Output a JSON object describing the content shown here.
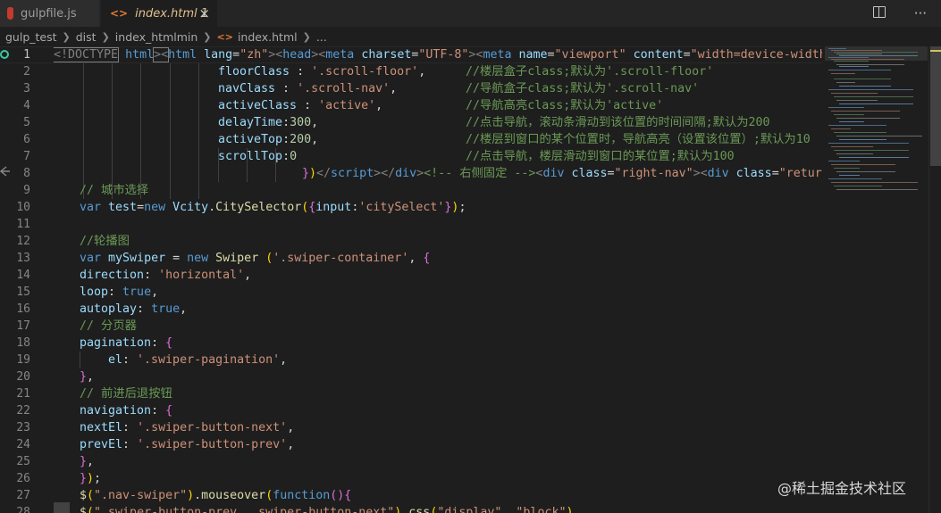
{
  "tabs": [
    {
      "label": "gulpfile.js",
      "icon": "gulp-icon",
      "active": false
    },
    {
      "label": "index.html",
      "icon": "html-icon",
      "badge": "1",
      "close": "×",
      "active": true
    }
  ],
  "breadcrumb": [
    "gulp_test",
    "dist",
    "index_htmlmin",
    "index.html",
    "..."
  ],
  "line_numbers": [
    "1",
    "2",
    "3",
    "4",
    "5",
    "6",
    "7",
    "8",
    "9",
    "10",
    "11",
    "12",
    "13",
    "14",
    "15",
    "16",
    "17",
    "18",
    "19",
    "20",
    "21",
    "22",
    "23",
    "24",
    "25",
    "26",
    "27",
    "28"
  ],
  "code": {
    "l1": [
      "<!DOCTYPE",
      " html",
      "><",
      "html",
      " lang",
      "=",
      "\"zh\"",
      "><",
      "head",
      "><",
      "meta",
      " charset",
      "=",
      "\"UTF-8\"",
      "><",
      "meta",
      " name",
      "=",
      "\"viewport\"",
      " content",
      "=",
      "\"width=device-width,ini"
    ],
    "l2": [
      "floorClass",
      " : ",
      "'.scroll-floor'",
      ",",
      "//楼层盒子class;默认为'.scroll-floor'"
    ],
    "l3": [
      "navClass",
      " : ",
      "'.scroll-nav'",
      ",",
      "//导航盒子class;默认为'.scroll-nav'"
    ],
    "l4": [
      "activeClass",
      " : ",
      "'active'",
      ",",
      "//导航高亮class;默认为'active'"
    ],
    "l5": [
      "delayTime",
      ":",
      "300",
      ",",
      "//点击导航，滚动条滑动到该位置的时间间隔;默认为200"
    ],
    "l6": [
      "activeTop",
      ":",
      "200",
      ",",
      "//楼层到窗口的某个位置时，导航高亮（设置该位置）;默认为10"
    ],
    "l7": [
      "scrollTop",
      ":",
      "0",
      "//点击导航，楼层滑动到窗口的某位置;默认为100"
    ],
    "l8": [
      "}",
      ")",
      "</",
      "script",
      "></",
      "div",
      ">",
      "<!-- 右侧固定 -->",
      "<",
      "div",
      " class",
      "=",
      "\"right-nav\"",
      "><",
      "div",
      " class",
      "=",
      "\"return-t"
    ],
    "l9": "// 城市选择",
    "l10": [
      "var",
      " test",
      "=",
      "new",
      " Vcity",
      ".",
      "CitySelector",
      "(",
      "{",
      "input",
      ":",
      "'citySelect'",
      "}",
      ")",
      ";"
    ],
    "l12": "//轮播图",
    "l13": [
      "var",
      " mySwiper",
      " = ",
      "new",
      " Swiper",
      " (",
      "'.swiper-container'",
      ", ",
      "{"
    ],
    "l14": [
      "direction",
      ": ",
      "'horizontal'",
      ","
    ],
    "l15": [
      "loop",
      ": ",
      "true",
      ","
    ],
    "l16": [
      "autoplay",
      ": ",
      "true",
      ","
    ],
    "l17": "// 分页器",
    "l18": [
      "pagination",
      ": ",
      "{"
    ],
    "l19": [
      "el",
      ": ",
      "'.swiper-pagination'",
      ","
    ],
    "l20": [
      "}",
      ","
    ],
    "l21": "// 前进后退按钮",
    "l22": [
      "navigation",
      ": ",
      "{"
    ],
    "l23": [
      "nextEl",
      ": ",
      "'.swiper-button-next'",
      ","
    ],
    "l24": [
      "prevEl",
      ": ",
      "'.swiper-button-prev'",
      ","
    ],
    "l25": [
      "}",
      ","
    ],
    "l26": [
      "}",
      ")",
      ";"
    ],
    "l27": [
      "$",
      "(",
      "\".nav-swiper\"",
      ")",
      ".",
      "mouseover",
      "(",
      "function",
      "(",
      ")",
      "{"
    ],
    "l28": [
      "$",
      "(",
      "\".swiper-button-prev, .swiper-button-next\"",
      ")",
      ".",
      "css",
      "(",
      "\"display\"",
      ", ",
      "\"block\"",
      ")"
    ]
  },
  "watermark": "@稀土掘金技术社区",
  "colors": {
    "keyword": "#569cd6",
    "string": "#ce9178",
    "comment": "#6a9955",
    "variable": "#9cdcfe",
    "function": "#dcdcaa",
    "bracket": "#da70d6"
  }
}
